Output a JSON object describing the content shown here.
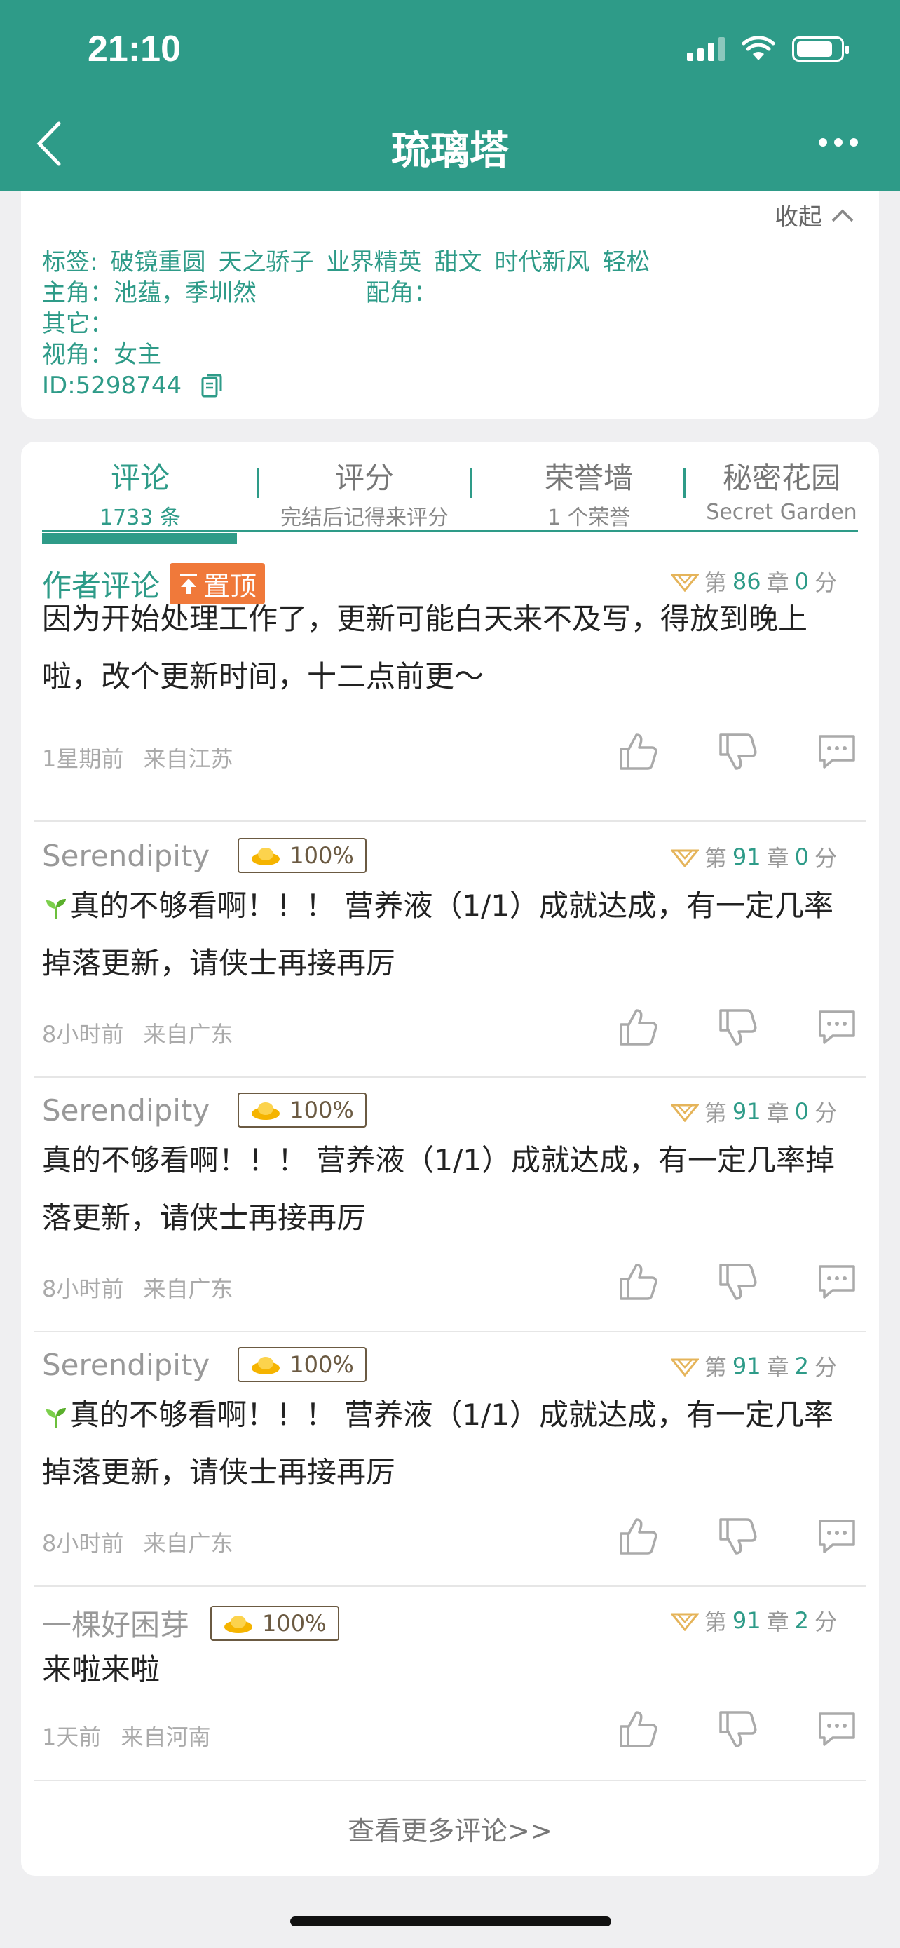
{
  "status_bar": {
    "time": "21:10"
  },
  "nav": {
    "title": "琉璃塔"
  },
  "info": {
    "collapse_label": "收起",
    "tags_label": "标签:",
    "tags": [
      "破镜重圆",
      "天之骄子",
      "业界精英",
      "甜文",
      "时代新风",
      "轻松"
    ],
    "protagonist": "主角：池蕴，季圳然",
    "supporting": "配角：",
    "other": "其它：",
    "perspective": "视角：女主",
    "id": "ID:5298744"
  },
  "tabs": [
    {
      "title": "评论",
      "sub": "1733 条"
    },
    {
      "title": "评分",
      "sub": "完结后记得来评分"
    },
    {
      "title": "荣誉墙",
      "sub": "1 个荣誉"
    },
    {
      "title": "秘密花园",
      "sub": "Secret Garden"
    }
  ],
  "comments": [
    {
      "user": "作者评论",
      "pin": "置顶",
      "chapter_prefix": "第",
      "chapter_num": "86",
      "chapter_suffix": "章",
      "score": "0",
      "score_unit": "分",
      "body": "因为开始处理工作了，更新可能白天来不及写，得放到晚上啦，改个更新时间，十二点前更～",
      "time": "1星期前",
      "location": "来自江苏"
    },
    {
      "user": "Serendipity",
      "badge": "100%",
      "chapter_prefix": "第",
      "chapter_num": "91",
      "chapter_suffix": "章",
      "score": "0",
      "score_unit": "分",
      "body": "真的不够看啊！！！ 营养液（1/1）成就达成，有一定几率掉落更新，请侠士再接再厉",
      "time": "8小时前",
      "location": "来自广东"
    },
    {
      "user": "Serendipity",
      "badge": "100%",
      "chapter_prefix": "第",
      "chapter_num": "91",
      "chapter_suffix": "章",
      "score": "0",
      "score_unit": "分",
      "body": "真的不够看啊！！！ 营养液（1/1）成就达成，有一定几率掉落更新，请侠士再接再厉",
      "time": "8小时前",
      "location": "来自广东"
    },
    {
      "user": "Serendipity",
      "badge": "100%",
      "chapter_prefix": "第",
      "chapter_num": "91",
      "chapter_suffix": "章",
      "score": "2",
      "score_unit": "分",
      "body": "真的不够看啊！！！ 营养液（1/1）成就达成，有一定几率掉落更新，请侠士再接再厉",
      "time": "8小时前",
      "location": "来自广东"
    },
    {
      "user": "一棵好困芽",
      "badge": "100%",
      "chapter_prefix": "第",
      "chapter_num": "91",
      "chapter_suffix": "章",
      "score": "2",
      "score_unit": "分",
      "body": "来啦来啦",
      "time": "1天前",
      "location": "来自河南"
    }
  ],
  "view_more": "查看更多评论>>",
  "colors": {
    "primary": "#2e9b88",
    "pin": "#f0793a",
    "badge": "#6b5a42"
  }
}
